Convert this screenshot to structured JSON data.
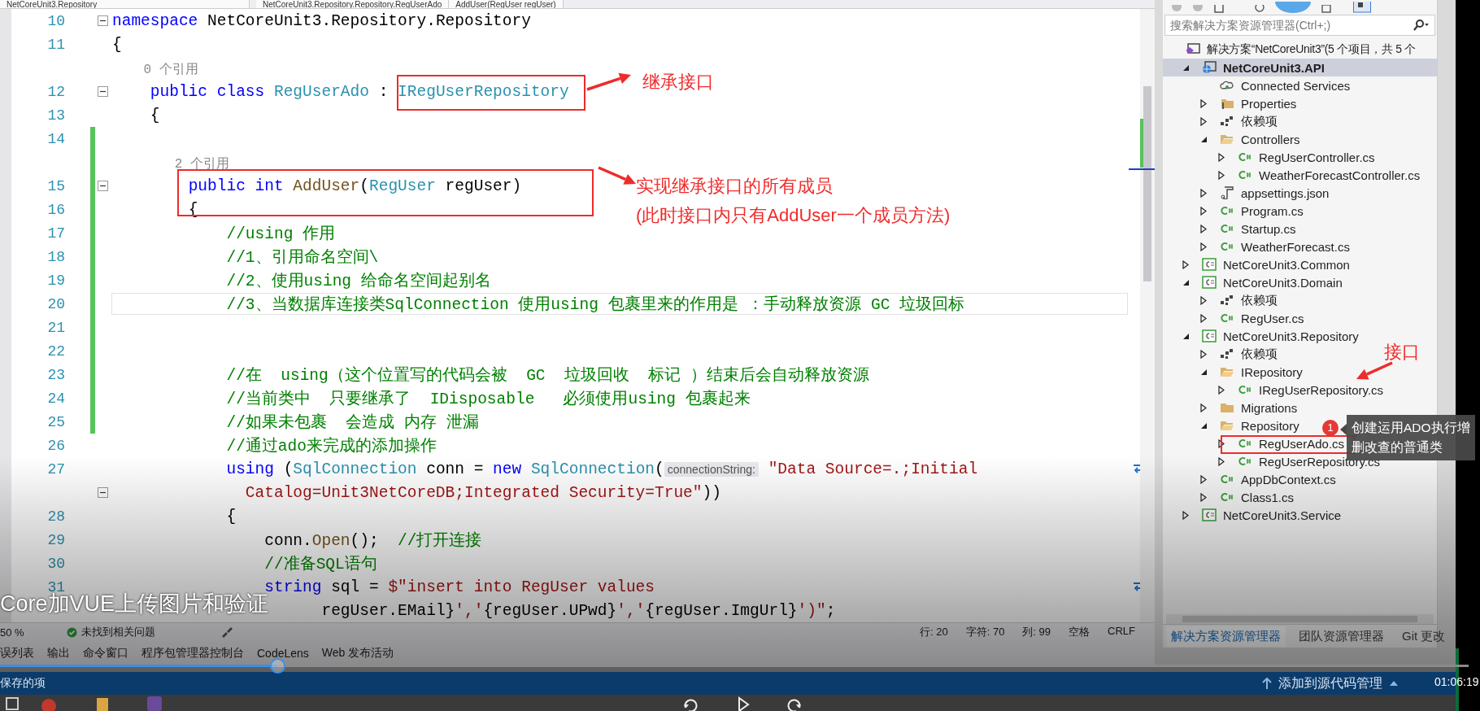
{
  "editor_tabs": [
    {
      "label": "NetCoreUnit3.Repository"
    },
    {
      "label": "NetCoreUnit3.Repository.Repository.RegUserAdo"
    },
    {
      "label": "AddUser(RegUser regUser)"
    }
  ],
  "code": {
    "rows": [
      {
        "kind": "code",
        "number": "10",
        "fold": true,
        "changed": false,
        "current": false,
        "tokens": [
          {
            "kind": "kw",
            "text": "namespace"
          },
          {
            "kind": "plain",
            "text": " NetCoreUnit3.Repository.Repository"
          }
        ]
      },
      {
        "kind": "code",
        "number": "11",
        "fold": false,
        "changed": false,
        "current": false,
        "tokens": [
          {
            "kind": "plain",
            "text": "{"
          }
        ]
      },
      {
        "kind": "codelens",
        "fold": false,
        "changed": false,
        "current": false,
        "text": "    0 个引用"
      },
      {
        "kind": "code",
        "number": "12",
        "fold": true,
        "changed": false,
        "current": false,
        "tokens": [
          {
            "kind": "kw",
            "text": "    public class "
          },
          {
            "kind": "type",
            "text": "RegUserAdo"
          },
          {
            "kind": "plain",
            "text": " : "
          },
          {
            "kind": "type",
            "text": "IRegUserRepository"
          }
        ]
      },
      {
        "kind": "code",
        "number": "13",
        "fold": false,
        "changed": false,
        "current": false,
        "tokens": [
          {
            "kind": "plain",
            "text": "    {"
          }
        ]
      },
      {
        "kind": "code",
        "number": "14",
        "fold": false,
        "changed": true,
        "current": false
      },
      {
        "kind": "codelens",
        "fold": false,
        "changed": true,
        "current": false,
        "text": "        2 个引用"
      },
      {
        "kind": "code",
        "number": "15",
        "fold": true,
        "changed": true,
        "current": false,
        "tokens": [
          {
            "kind": "kw",
            "text": "        public int "
          },
          {
            "kind": "method",
            "text": "AddUser"
          },
          {
            "kind": "plain",
            "text": "("
          },
          {
            "kind": "type",
            "text": "RegUser"
          },
          {
            "kind": "plain",
            "text": " regUser)"
          }
        ]
      },
      {
        "kind": "code",
        "number": "16",
        "fold": false,
        "changed": true,
        "current": false,
        "tokens": [
          {
            "kind": "plain",
            "text": "        {"
          }
        ]
      },
      {
        "kind": "code",
        "number": "17",
        "fold": false,
        "changed": true,
        "current": false,
        "tokens": [
          {
            "kind": "comment",
            "text": "            //using 作用"
          }
        ]
      },
      {
        "kind": "code",
        "number": "18",
        "fold": false,
        "changed": true,
        "current": false,
        "tokens": [
          {
            "kind": "comment",
            "text": "            //1、引用命名空间\\"
          }
        ]
      },
      {
        "kind": "code",
        "number": "19",
        "fold": false,
        "changed": true,
        "current": false,
        "tokens": [
          {
            "kind": "comment",
            "text": "            //2、使用using 给命名空间起别名"
          }
        ]
      },
      {
        "kind": "code",
        "number": "20",
        "fold": false,
        "changed": true,
        "current": true,
        "tokens": [
          {
            "kind": "comment",
            "text": "            //3、当数据库连接类SqlConnection 使用using 包裹里来的作用是 ：手动释放资源 GC 垃圾回标"
          }
        ]
      },
      {
        "kind": "code",
        "number": "21",
        "fold": false,
        "changed": true,
        "current": false
      },
      {
        "kind": "code",
        "number": "22",
        "fold": false,
        "changed": true,
        "current": false
      },
      {
        "kind": "code",
        "number": "23",
        "fold": false,
        "changed": true,
        "current": false,
        "tokens": [
          {
            "kind": "comment",
            "text": "            //在  using（这个位置写的代码会被  GC  垃圾回收  标记 ）结束后会自动释放资源"
          }
        ]
      },
      {
        "kind": "code",
        "number": "24",
        "fold": false,
        "changed": true,
        "current": false,
        "tokens": [
          {
            "kind": "comment",
            "text": "            //当前类中  只要继承了  IDisposable   必须使用using 包裹起来"
          }
        ]
      },
      {
        "kind": "code",
        "number": "25",
        "fold": false,
        "changed": true,
        "current": false,
        "tokens": [
          {
            "kind": "comment",
            "text": "            //如果未包裹  会造成 内存 泄漏"
          }
        ]
      },
      {
        "kind": "code",
        "number": "26",
        "fold": false,
        "changed": false,
        "current": false,
        "tokens": [
          {
            "kind": "comment",
            "text": "            //通过ado来完成的添加操作"
          }
        ]
      },
      {
        "kind": "code",
        "number": "27",
        "fold": false,
        "changed": false,
        "current": false,
        "tokens": [
          {
            "kind": "kw",
            "text": "            using"
          },
          {
            "kind": "plain",
            "text": " ("
          },
          {
            "kind": "type",
            "text": "SqlConnection"
          },
          {
            "kind": "plain",
            "text": " conn = "
          },
          {
            "kind": "kw",
            "text": "new "
          },
          {
            "kind": "type",
            "text": "SqlConnection"
          },
          {
            "kind": "plain",
            "text": "("
          },
          {
            "kind": "hint",
            "text": "connectionString:"
          },
          {
            "kind": "string",
            "text": " \"Data Source=.;Initial"
          }
        ]
      },
      {
        "kind": "wrap",
        "fold": true,
        "changed": false,
        "current": false,
        "tokens": [
          {
            "kind": "string",
            "text": "              Catalog=Unit3NetCoreDB;Integrated Security=True\""
          },
          {
            "kind": "plain",
            "text": "))"
          }
        ]
      },
      {
        "kind": "code",
        "number": "28",
        "fold": false,
        "changed": false,
        "current": false,
        "tokens": [
          {
            "kind": "plain",
            "text": "            {"
          }
        ]
      },
      {
        "kind": "code",
        "number": "29",
        "fold": false,
        "changed": false,
        "current": false,
        "tokens": [
          {
            "kind": "plain",
            "text": "                conn."
          },
          {
            "kind": "method",
            "text": "Open"
          },
          {
            "kind": "plain",
            "text": "();  "
          },
          {
            "kind": "comment",
            "text": "//打开连接"
          }
        ]
      },
      {
        "kind": "code",
        "number": "30",
        "fold": false,
        "changed": false,
        "current": false,
        "tokens": [
          {
            "kind": "comment",
            "text": "                //准备SQL语句"
          }
        ]
      },
      {
        "kind": "code",
        "number": "31",
        "fold": false,
        "changed": false,
        "current": false,
        "tokens": [
          {
            "kind": "kw",
            "text": "                string"
          },
          {
            "kind": "plain",
            "text": " sql = "
          },
          {
            "kind": "string",
            "text": "$\"insert into RegUser values"
          }
        ]
      },
      {
        "kind": "wrap",
        "fold": false,
        "changed": false,
        "current": false,
        "tokens": [
          {
            "kind": "plain",
            "text": "                      regUser.EMail}"
          },
          {
            "kind": "string",
            "text": "','"
          },
          {
            "kind": "plain",
            "text": "{regUser.UPwd}"
          },
          {
            "kind": "string",
            "text": "','"
          },
          {
            "kind": "plain",
            "text": "{regUser.ImgUrl}"
          },
          {
            "kind": "string",
            "text": "')\""
          },
          {
            "kind": "plain",
            "text": ";"
          }
        ]
      }
    ]
  },
  "annotations": {
    "callouts": [
      {
        "lines": [
          "继承接口"
        ]
      },
      {
        "lines": [
          "实现继承接口的所有成员",
          "(此时接口内只有AddUser一个成员方法)"
        ]
      },
      {
        "lines": [
          "接口"
        ]
      }
    ],
    "tooltip": {
      "badge": "1",
      "lines": [
        "创建运用ADO执行增",
        "删改查的普通类"
      ]
    }
  },
  "explorer": {
    "search": {
      "placeholder": "搜索解决方案资源管理器(Ctrl+;)"
    },
    "tree": {
      "label": "解决方案“NetCoreUnit3”(5 个项目，共 5 个",
      "kind": "solution",
      "selected": false,
      "children": [
        {
          "label": "NetCoreUnit3.API",
          "kind": "web",
          "expanded": true,
          "selected": true,
          "children": [
            {
              "label": "Connected Services",
              "kind": "cloud",
              "selected": false
            },
            {
              "label": "Properties",
              "kind": "properties",
              "expanded": false,
              "selected": false
            },
            {
              "label": "依赖项",
              "kind": "deps",
              "expanded": false,
              "selected": false
            },
            {
              "label": "Controllers",
              "kind": "folder-open",
              "expanded": true,
              "selected": false,
              "children": [
                {
                  "label": "RegUserController.cs",
                  "kind": "csharp",
                  "expanded": false,
                  "selected": false
                },
                {
                  "label": "WeatherForecastController.cs",
                  "kind": "csharp",
                  "expanded": false,
                  "selected": false
                }
              ]
            },
            {
              "label": "appsettings.json",
              "kind": "json",
              "expanded": false,
              "selected": false
            },
            {
              "label": "Program.cs",
              "kind": "csharp",
              "expanded": false,
              "selected": false
            },
            {
              "label": "Startup.cs",
              "kind": "csharp",
              "expanded": false,
              "selected": false
            },
            {
              "label": "WeatherForecast.cs",
              "kind": "csharp",
              "expanded": false,
              "selected": false
            }
          ]
        },
        {
          "label": "NetCoreUnit3.Common",
          "kind": "csproj",
          "expanded": false,
          "selected": false
        },
        {
          "label": "NetCoreUnit3.Domain",
          "kind": "csproj",
          "expanded": true,
          "selected": false,
          "children": [
            {
              "label": "依赖项",
              "kind": "deps",
              "expanded": false,
              "selected": false
            },
            {
              "label": "RegUser.cs",
              "kind": "csharp",
              "expanded": false,
              "selected": false
            }
          ]
        },
        {
          "label": "NetCoreUnit3.Repository",
          "kind": "csproj",
          "expanded": true,
          "selected": false,
          "children": [
            {
              "label": "依赖项",
              "kind": "deps",
              "expanded": false,
              "selected": false
            },
            {
              "label": "IRepository",
              "kind": "folder-open",
              "expanded": true,
              "selected": false,
              "children": [
                {
                  "label": "IRegUserRepository.cs",
                  "kind": "csharp",
                  "expanded": false,
                  "selected": false
                }
              ]
            },
            {
              "label": "Migrations",
              "kind": "folder",
              "expanded": false,
              "selected": false
            },
            {
              "label": "Repository",
              "kind": "folder-open",
              "expanded": true,
              "selected": false,
              "children": [
                {
                  "label": "RegUserAdo.cs",
                  "kind": "csharp",
                  "expanded": false,
                  "selected": false
                },
                {
                  "label": "RegUserRepository.cs",
                  "kind": "csharp",
                  "expanded": false,
                  "selected": false
                }
              ]
            },
            {
              "label": "AppDbContext.cs",
              "kind": "csharp",
              "expanded": false,
              "selected": false
            },
            {
              "label": "Class1.cs",
              "kind": "csharp",
              "expanded": false,
              "selected": false
            }
          ]
        },
        {
          "label": "NetCoreUnit3.Service",
          "kind": "csproj",
          "expanded": false,
          "selected": false
        }
      ]
    },
    "tabs": [
      {
        "label": "解决方案资源管理器",
        "selected": true
      },
      {
        "label": "团队资源管理器",
        "selected": false
      },
      {
        "label": "Git 更改",
        "selected": false
      }
    ]
  },
  "status_bar": {
    "zoom": "50 %",
    "issues": "未找到相关问题",
    "position": [
      "行: 20",
      "字符: 70",
      "列: 99",
      "空格",
      "CRLF"
    ]
  },
  "tool_tabs": [
    "误列表",
    "输出",
    "命令窗口",
    "程序包管理器控制台",
    "CodeLens",
    "Web 发布活动"
  ],
  "bottom_bar": {
    "left": "保存的项",
    "source_control": "添加到源代码管理"
  },
  "video": {
    "caption": "Core加VUE上传图片和验证",
    "progress": {
      "level": 0.189
    },
    "time": "01:06:19"
  }
}
